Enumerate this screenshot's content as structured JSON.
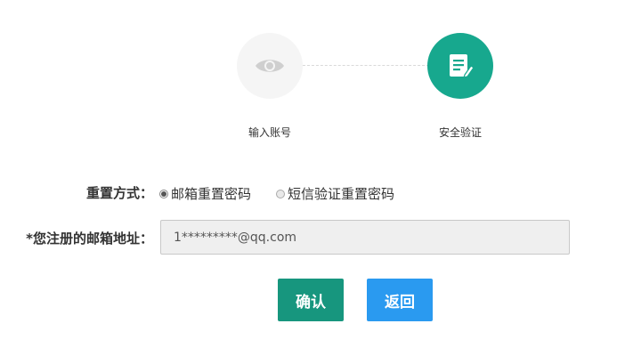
{
  "steps": [
    {
      "label": "输入账号",
      "icon": "eye-icon",
      "active": false
    },
    {
      "label": "安全验证",
      "icon": "document-edit-icon",
      "active": true
    }
  ],
  "reset": {
    "label": "重置方式：",
    "options": [
      {
        "label": "邮箱重置密码",
        "selected": true
      },
      {
        "label": "短信验证重置密码",
        "selected": false
      }
    ]
  },
  "email": {
    "label": "*您注册的邮箱地址：",
    "value": "1*********@qq.com"
  },
  "buttons": {
    "confirm": "确认",
    "back": "返回"
  },
  "colors": {
    "accent": "#17a88e",
    "confirm": "#17967e",
    "back": "#2a9af0"
  }
}
